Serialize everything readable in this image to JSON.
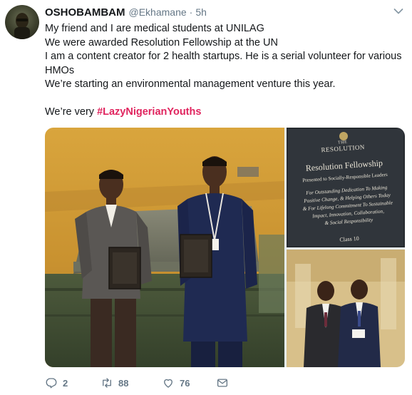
{
  "tweet": {
    "author_name": "OSHOBAMBAM",
    "author_handle": "@Ekhamane",
    "separator": "·",
    "time": "5h",
    "lines": [
      "My friend and I are medical students at UNILAG",
      "We were awarded Resolution Fellowship at the UN",
      "I am a content creator for 2 health startups. He is a serial volunteer for various HMOs",
      "We’re starting an environmental management venture this year."
    ],
    "closing_prefix": "We’re very ",
    "hashtag": "#LazyNigerianYouths"
  },
  "media": {
    "plaque": {
      "brand_small": "THE",
      "brand": "RESOLUTION",
      "title": "Resolution Fellowship",
      "subtitle": "Presented to Socially-Responsible Leaders",
      "lines": [
        "For Outstanding Dedication To Making",
        "Positive Change, & Helping Others Today",
        "& For Lifelong Commitment To Sustainable",
        "Impact, Innovation, Collaboration,",
        "& Social Responsibility"
      ],
      "class_label": "Class 10"
    }
  },
  "actions": {
    "replies": "2",
    "retweets": "88",
    "likes": "76"
  },
  "colors": {
    "hashtag": "#e0245e",
    "muted": "#657786",
    "text": "#14171a"
  },
  "icons": [
    "caret-down-icon",
    "reply-icon",
    "retweet-icon",
    "like-icon",
    "message-icon"
  ]
}
